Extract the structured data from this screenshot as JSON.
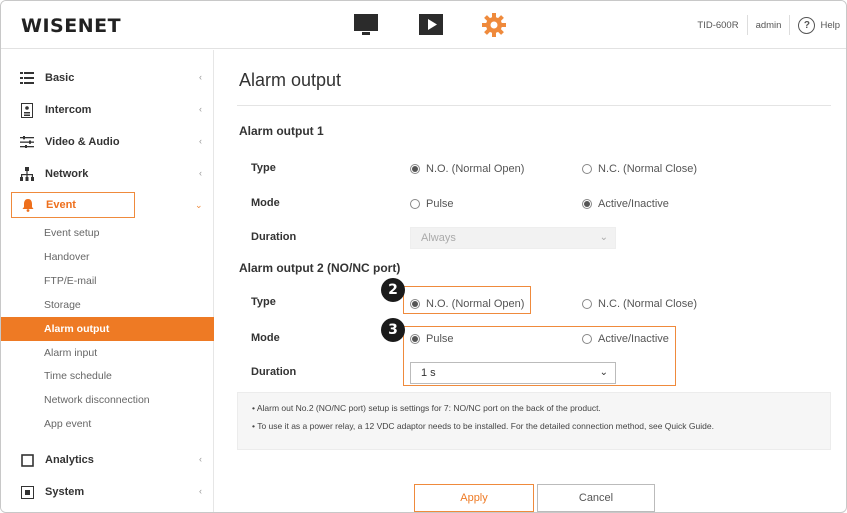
{
  "header": {
    "logo": "WISENET",
    "model": "TID-600R",
    "user": "admin",
    "help_label": "Help",
    "nav_icons": [
      "monitor-icon",
      "play-icon",
      "gear-icon"
    ],
    "accent_color": "#ef8a3c"
  },
  "sidebar": {
    "groups": [
      {
        "label": "Basic",
        "icon": "list-icon"
      },
      {
        "label": "Intercom",
        "icon": "intercom-icon"
      },
      {
        "label": "Video & Audio",
        "icon": "sliders-icon"
      },
      {
        "label": "Network",
        "icon": "network-icon"
      },
      {
        "label": "Event",
        "icon": "bell-icon"
      },
      {
        "label": "Analytics",
        "icon": "square-icon"
      },
      {
        "label": "System",
        "icon": "system-icon"
      }
    ],
    "event_items": [
      {
        "label": "Event setup"
      },
      {
        "label": "Handover"
      },
      {
        "label": "FTP/E-mail"
      },
      {
        "label": "Storage"
      },
      {
        "label": "Alarm output"
      },
      {
        "label": "Alarm input"
      },
      {
        "label": "Time schedule"
      },
      {
        "label": "Network disconnection"
      },
      {
        "label": "App event"
      }
    ],
    "selected_item": "Alarm output"
  },
  "main": {
    "title": "Alarm output",
    "output1": {
      "title": "Alarm output 1",
      "type_label": "Type",
      "type_options": [
        "N.O. (Normal Open)",
        "N.C. (Normal Close)"
      ],
      "type_selected": "N.O. (Normal Open)",
      "mode_label": "Mode",
      "mode_options": [
        "Pulse",
        "Active/Inactive"
      ],
      "mode_selected": "Active/Inactive",
      "duration_label": "Duration",
      "duration_value": "Always"
    },
    "output2": {
      "title": "Alarm output 2 (NO/NC port)",
      "type_label": "Type",
      "type_options": [
        "N.O. (Normal Open)",
        "N.C. (Normal Close)"
      ],
      "type_selected": "N.O. (Normal Open)",
      "mode_label": "Mode",
      "mode_options": [
        "Pulse",
        "Active/Inactive"
      ],
      "mode_selected": "Pulse",
      "duration_label": "Duration",
      "duration_value": "1 s"
    },
    "callouts": [
      "2",
      "3"
    ],
    "notes": [
      "Alarm out No.2 (NO/NC port) setup is settings for 7: NO/NC port on the back of the product.",
      "To use it as a power relay, a 12 VDC adaptor needs to be installed. For the detailed connection method, see Quick Guide."
    ],
    "apply_label": "Apply",
    "cancel_label": "Cancel"
  }
}
